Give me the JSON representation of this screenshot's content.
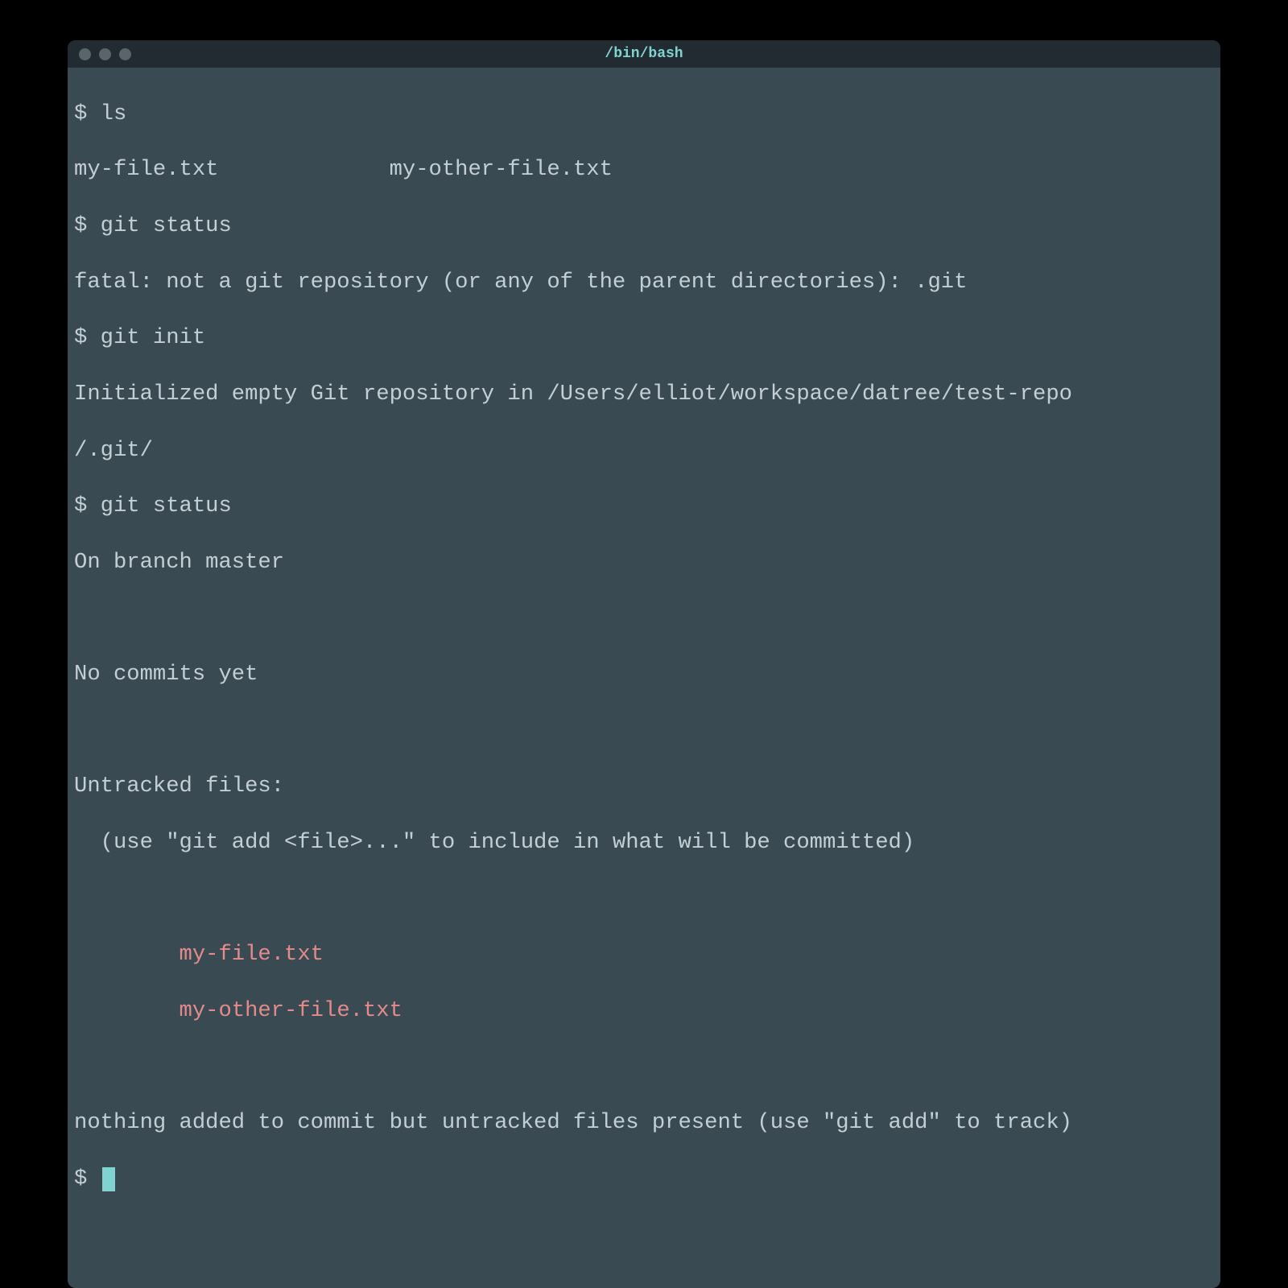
{
  "window": {
    "title": "/bin/bash"
  },
  "prompt": "$ ",
  "session": {
    "cmd1": "ls",
    "out1": "my-file.txt             my-other-file.txt",
    "cmd2": "git status",
    "out2": "fatal: not a git repository (or any of the parent directories): .git",
    "cmd3": "git init",
    "out3a": "Initialized empty Git repository in /Users/elliot/workspace/datree/test-repo",
    "out3b": "/.git/",
    "cmd4": "git status",
    "out4a": "On branch master",
    "blank1": "",
    "out4b": "No commits yet",
    "blank2": "",
    "out4c": "Untracked files:",
    "out4d": "  (use \"git add <file>...\" to include in what will be committed)",
    "blank3": "",
    "indent": "        ",
    "untracked1": "my-file.txt",
    "untracked2": "my-other-file.txt",
    "blank4": "",
    "out4e": "nothing added to commit but untracked files present (use \"git add\" to track)"
  },
  "colors": {
    "bg": "#3a4a52",
    "titlebar": "#232b32",
    "text": "#c3cfd4",
    "accent": "#7fd3d0",
    "untracked": "#e38b8b"
  }
}
